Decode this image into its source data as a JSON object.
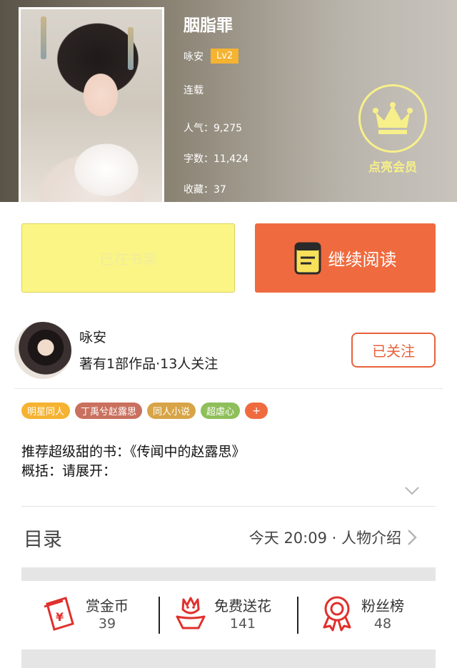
{
  "book": {
    "title": "胭脂罪",
    "author": "咏安",
    "level": "Lv2",
    "status": "连载",
    "popularity": "人气：9,275",
    "word_count": "字数：11,424",
    "favorites": "收藏：37"
  },
  "vip": {
    "label": "点亮会员"
  },
  "actions": {
    "shelf_label": "已在书架",
    "read_label": "继续阅读"
  },
  "author": {
    "name": "咏安",
    "meta": "著有1部作品·13人关注",
    "follow_label": "已关注"
  },
  "tags": [
    {
      "label": "明星同人",
      "color": "#f5b331"
    },
    {
      "label": "丁禹兮赵露思",
      "color": "#c9705e"
    },
    {
      "label": "同人小说",
      "color": "#d7a447"
    },
    {
      "label": "超虐心",
      "color": "#8fbf5a"
    }
  ],
  "tag_more": "+",
  "description": {
    "line1": "推荐超级甜的书：《传闻中的赵露思》",
    "line2": "概括：请展开："
  },
  "toc": {
    "title": "目录",
    "info": "今天 20:09 · 人物介绍"
  },
  "stats": {
    "reward": {
      "label": "赏金币",
      "value": "39"
    },
    "flowers": {
      "label": "免费送花",
      "value": "141"
    },
    "fans": {
      "label": "粉丝榜",
      "value": "48"
    }
  },
  "colors": {
    "accent": "#ef6b3f",
    "shelf_button": "#fbf586",
    "vip_yellow": "#f7f08a",
    "icon_red": "#e0302c"
  }
}
